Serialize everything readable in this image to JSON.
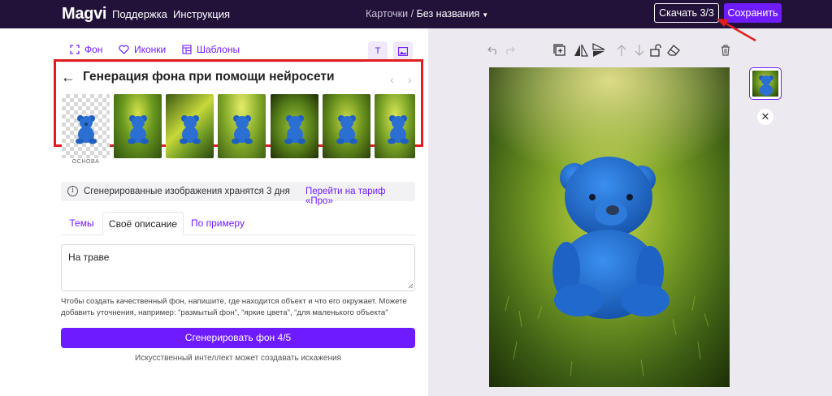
{
  "topbar": {
    "logo": "Magvi",
    "nav": [
      "Поддержка",
      "Инструкция"
    ],
    "breadcrumb_parent": "Карточки /",
    "breadcrumb_current": "Без названия",
    "download_label": "Скачать 3/3",
    "save_label": "Сохранить"
  },
  "panel": {
    "tabs": [
      "Фон",
      "Иконки",
      "Шаблоны"
    ],
    "heading": "Генерация фона при помощи нейросети",
    "base_label": "ОСНОВА",
    "info_text": "Сгенерированные изображения хранятся 3 дня",
    "info_link": "Перейти на тариф «Про»",
    "desc_tabs": [
      "Темы",
      "Своё описание",
      "По примеру"
    ],
    "active_desc_tab": "Своё описание",
    "textarea_value": "На траве",
    "hint": "Чтобы создать качественный фон, напишите, где находится объект и что его окружает. Можете добавить уточнения, например: “размытый фон”, “яркие цвета”, “для маленького объекта”",
    "generate_label": "Сгенерировать фон 4/5",
    "note": "Искусственный интеллект может создавать искажения"
  },
  "colors": {
    "accent": "#6f1bff",
    "topbar_bg": "#22123a",
    "highlight_red": "#e11d20",
    "canvas_bg": "#eceaf0"
  },
  "icons": {
    "tabs": [
      "frame-icon",
      "heart-icon",
      "template-icon"
    ],
    "toolbar": [
      "undo-icon",
      "redo-icon",
      "add-layer-icon",
      "flip-horizontal-icon",
      "flip-vertical-icon",
      "move-up-icon",
      "move-down-icon",
      "lock-icon",
      "eraser-icon",
      "trash-icon"
    ]
  }
}
